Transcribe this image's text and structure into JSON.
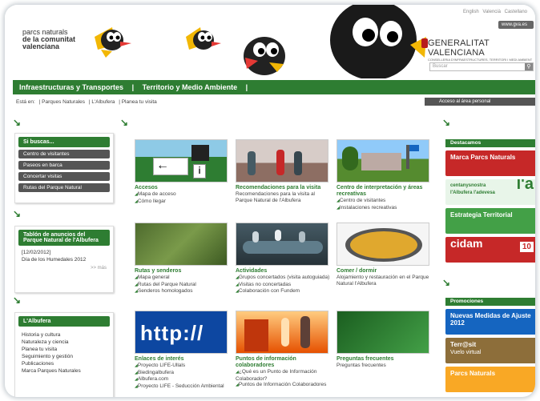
{
  "header": {
    "lang_links": [
      "English",
      "Valencià",
      "Castellano"
    ],
    "logo_lines": [
      "parcs naturals",
      "de la comunitat",
      "valenciana"
    ],
    "gva_tag": "www.gva.es",
    "gva_name": "GENERALITAT VALENCIANA",
    "gva_sub": "CONSELLERIA D'INFRAESTRUCTURES, TERRITORI I MEDI AMBIENT",
    "search_placeholder": "Buscar",
    "search_icon": "magnifier-icon"
  },
  "nav": {
    "items": [
      "Infraestructuras y Transportes",
      "Territorio y Medio Ambiente"
    ],
    "separator": "|"
  },
  "breadcrumb": {
    "label": "Está en:",
    "items": [
      "| Parques Naturales",
      "| L'Albufera",
      "| Planea tu visita"
    ]
  },
  "access_link": "Acceso al área personal",
  "left": {
    "search_box": {
      "title": "Si buscas...",
      "items": [
        "Centro de visitantes",
        "Paseos en barca",
        "Concertar visitas",
        "Rutas del Parque Natural"
      ]
    },
    "notice_box": {
      "title": "Tablón de anuncios del Parque Natural de l'Albufera",
      "date": "[12/02/2012]",
      "text": "Día de los Humedales 2012",
      "more": ">> más"
    },
    "albufera_box": {
      "title": "L'Albufera",
      "items": [
        "Historia y cultura",
        "Naturaleza y ciencia",
        "Planea tu visita",
        "Seguimiento y gestión",
        "Publicaciones",
        "Marca Parques Naturales"
      ]
    }
  },
  "cards": [
    {
      "title": "Accesos",
      "links": [
        "Mapa de acceso",
        "Cómo llegar"
      ],
      "plain": []
    },
    {
      "title": "Recomendaciones para la visita",
      "links": [],
      "plain": [
        "Recomendaciones para la visita al Parque Natural de l'Albufera"
      ]
    },
    {
      "title": "Centro de interpretación y áreas recreativas",
      "links": [
        "Centro de visitantes",
        "Instalaciones recreativas"
      ],
      "plain": []
    },
    {
      "title": "Rutas y senderos",
      "links": [
        "Mapa general",
        "Rutas del Parque Natural",
        "Senderos homologados"
      ],
      "plain": []
    },
    {
      "title": "Actividades",
      "links": [
        "Grupos concertados (visita autoguiada)",
        "Visitas no concertadas",
        "Colaboración con Fundem"
      ],
      "plain": []
    },
    {
      "title": "Comer / dormir",
      "links": [],
      "plain": [
        "Alojamiento y restauración en el Parque Natural l'Albufera"
      ]
    },
    {
      "title": "Enlaces de interés",
      "links": [
        "Proyecto LIFE-Ullals",
        "Biedingalbufera",
        "Albufera.com",
        "Proyecto LIFE - Seducción Ambiental"
      ],
      "plain": []
    },
    {
      "title": "Puntos de información colaboradores",
      "links": [
        "¿Qué es un Punto de Información Colaborador?",
        "Puntos de Información Colaboradores"
      ],
      "plain": []
    },
    {
      "title": "Preguntas frecuentes",
      "links": [],
      "plain": [
        "Preguntas frecuentes"
      ]
    }
  ],
  "thumb_text": {
    "http": "http://"
  },
  "right": {
    "destacamos_title": "Destacamos",
    "banners": [
      {
        "text": "Marca Parcs Naturals",
        "color": "#c62828"
      },
      {
        "text": "centanysnostra l'Albufera l'adevesa",
        "big": "l'a",
        "color": "#388e3c"
      },
      {
        "text": "Estrategia Territorial",
        "color": "#43a047"
      },
      {
        "text": "cidam",
        "num": "10",
        "color": "#c62828"
      }
    ],
    "promociones_title": "Promociones",
    "promos": [
      {
        "text": "Nuevas Medidas de Ajuste 2012",
        "color": "#1565c0"
      },
      {
        "text": "Terr@sit",
        "sub": "Vuelo virtual",
        "color": "#8d6e3a"
      },
      {
        "text": "Parcs Naturals",
        "color": "#f9a825"
      }
    ]
  },
  "colors": {
    "brand_green": "#2e7d32",
    "dark_gray": "#555555"
  }
}
